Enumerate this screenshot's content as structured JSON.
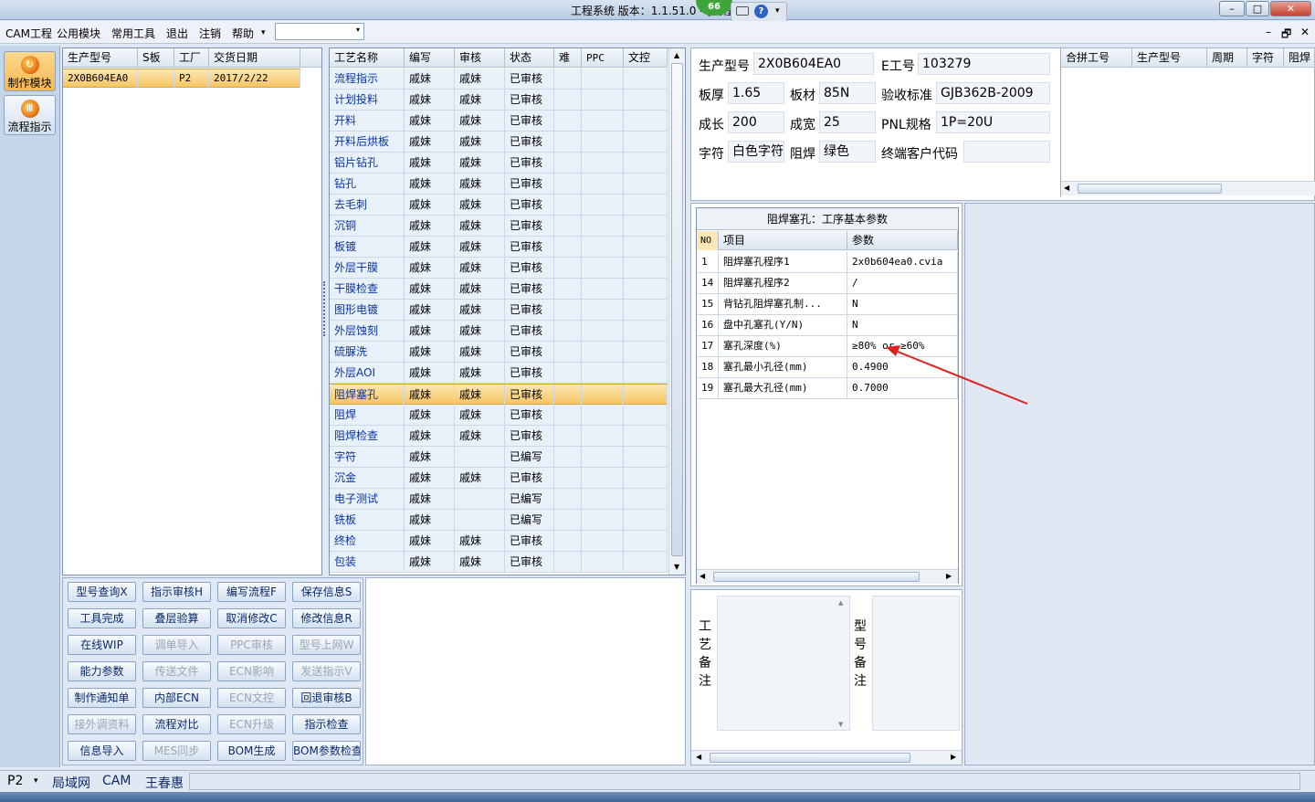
{
  "window": {
    "title": "工程系统   版本：1.1.51.0 - [流程指",
    "badge": "66",
    "min": "–",
    "max": "□",
    "close": "✕"
  },
  "menu": {
    "items": [
      "CAM工程",
      "公用模块",
      "常用工具",
      "退出",
      "注销",
      "帮助"
    ],
    "help_arrow": "▾",
    "combo_value": "",
    "combo_arrow": "▾",
    "mdi": [
      "–",
      "🗗",
      "✕"
    ]
  },
  "nav": [
    {
      "label": "制作模块",
      "icon": "flame-icon"
    },
    {
      "label": "流程指示",
      "icon": "process-icon"
    }
  ],
  "order_grid": {
    "headers": [
      "生产型号",
      "S板",
      "工厂",
      "交货日期"
    ],
    "rows": [
      [
        "2X0B604EA0",
        "",
        "P2",
        "2017/2/22"
      ]
    ]
  },
  "process_grid": {
    "headers": [
      "工艺名称",
      "编写",
      "审核",
      "状态",
      "难",
      "PPC",
      "文控"
    ],
    "rows": [
      [
        "流程指示",
        "戚妹",
        "戚妹",
        "已审核"
      ],
      [
        "计划投料",
        "戚妹",
        "戚妹",
        "已审核"
      ],
      [
        "开料",
        "戚妹",
        "戚妹",
        "已审核"
      ],
      [
        "开料后烘板",
        "戚妹",
        "戚妹",
        "已审核"
      ],
      [
        "铝片钻孔",
        "戚妹",
        "戚妹",
        "已审核"
      ],
      [
        "钻孔",
        "戚妹",
        "戚妹",
        "已审核"
      ],
      [
        "去毛刺",
        "戚妹",
        "戚妹",
        "已审核"
      ],
      [
        "沉铜",
        "戚妹",
        "戚妹",
        "已审核"
      ],
      [
        "板镀",
        "戚妹",
        "戚妹",
        "已审核"
      ],
      [
        "外层干膜",
        "戚妹",
        "戚妹",
        "已审核"
      ],
      [
        "干膜检查",
        "戚妹",
        "戚妹",
        "已审核"
      ],
      [
        "图形电镀",
        "戚妹",
        "戚妹",
        "已审核"
      ],
      [
        "外层蚀刻",
        "戚妹",
        "戚妹",
        "已审核"
      ],
      [
        "硫脲洗",
        "戚妹",
        "戚妹",
        "已审核"
      ],
      [
        "外层AOI",
        "戚妹",
        "戚妹",
        "已审核"
      ],
      [
        "阻焊塞孔",
        "戚妹",
        "戚妹",
        "已审核"
      ],
      [
        "阻焊",
        "戚妹",
        "戚妹",
        "已审核"
      ],
      [
        "阻焊检查",
        "戚妹",
        "戚妹",
        "已审核"
      ],
      [
        "字符",
        "戚妹",
        "",
        "已编写"
      ],
      [
        "沉金",
        "戚妹",
        "戚妹",
        "已审核"
      ],
      [
        "电子测试",
        "戚妹",
        "",
        "已编写"
      ],
      [
        "铣板",
        "戚妹",
        "",
        "已编写"
      ],
      [
        "终检",
        "戚妹",
        "戚妹",
        "已审核"
      ],
      [
        "包装",
        "戚妹",
        "戚妹",
        "已审核"
      ]
    ],
    "selected_index": 15
  },
  "buttons": [
    [
      "型号查询X",
      "指示审核H",
      "编写流程F",
      "保存信息S"
    ],
    [
      "工具完成",
      "叠层验算",
      "取消修改C",
      "修改信息R"
    ],
    [
      "在线WIP",
      "调单导入",
      "PPC审核",
      "型号上网W"
    ],
    [
      "能力参数",
      "传送文件",
      "ECN影响",
      "发送指示V"
    ],
    [
      "制作通知单",
      "内部ECN",
      "ECN文控",
      "回退审核B"
    ],
    [
      "接外调资料",
      "流程对比",
      "ECN升级",
      "指示检查"
    ],
    [
      "信息导入",
      "MES同步",
      "BOM生成",
      "BOM参数检查"
    ]
  ],
  "disabled_buttons": [
    "调单导入",
    "PPC审核",
    "型号上网W",
    "传送文件",
    "ECN影响",
    "发送指示V",
    "ECN文控",
    "接外调资料",
    "ECN升级",
    "MES同步"
  ],
  "info": {
    "model_label": "生产型号",
    "model": "2X0B604EA0",
    "eno_label": "E工号",
    "eno": "103279",
    "thick_label": "板厚",
    "thick": "1.65",
    "mat_label": "板材",
    "mat": "85N",
    "std_label": "验收标准",
    "std": "GJB362B-2009",
    "len_label": "成长",
    "len": "200",
    "wid_label": "成宽",
    "wid": "25",
    "pnl_label": "PNL规格",
    "pnl": "1P=20U",
    "char_label": "字符",
    "char": "白色字符",
    "mask_label": "阻焊",
    "mask": "绿色",
    "cust_label": "终端客户代码",
    "cust": ""
  },
  "merge_grid": {
    "headers": [
      "合拼工号",
      "生产型号",
      "周期",
      "字符",
      "阻焊"
    ]
  },
  "param_grid": {
    "title": "阻焊塞孔：工序基本参数",
    "headers": [
      "NO",
      "项目",
      "参数"
    ],
    "rows": [
      [
        "1",
        "阻焊塞孔程序1",
        "2x0b604ea0.cvia"
      ],
      [
        "14",
        "阻焊塞孔程序2",
        "/"
      ],
      [
        "15",
        "背钻孔阻焊塞孔制...",
        "N"
      ],
      [
        "16",
        "盘中孔塞孔(Y/N)",
        "N"
      ],
      [
        "17",
        "塞孔深度(%)",
        "≥80% or ≥60%"
      ],
      [
        "18",
        "塞孔最小孔径(mm)",
        "0.4900"
      ],
      [
        "19",
        "塞孔最大孔径(mm)",
        "0.7000"
      ]
    ]
  },
  "notes": {
    "process_note_label": [
      "工",
      "艺",
      "备",
      "注"
    ],
    "model_note_label": [
      "型",
      "号",
      "备",
      "注"
    ]
  },
  "status": {
    "plant": "P2",
    "arrow": "▾",
    "items": [
      "局域网",
      "CAM",
      "王春惠"
    ]
  },
  "colors": {
    "selection": "#f6c563",
    "annotation_arrow": "#e0201c"
  }
}
